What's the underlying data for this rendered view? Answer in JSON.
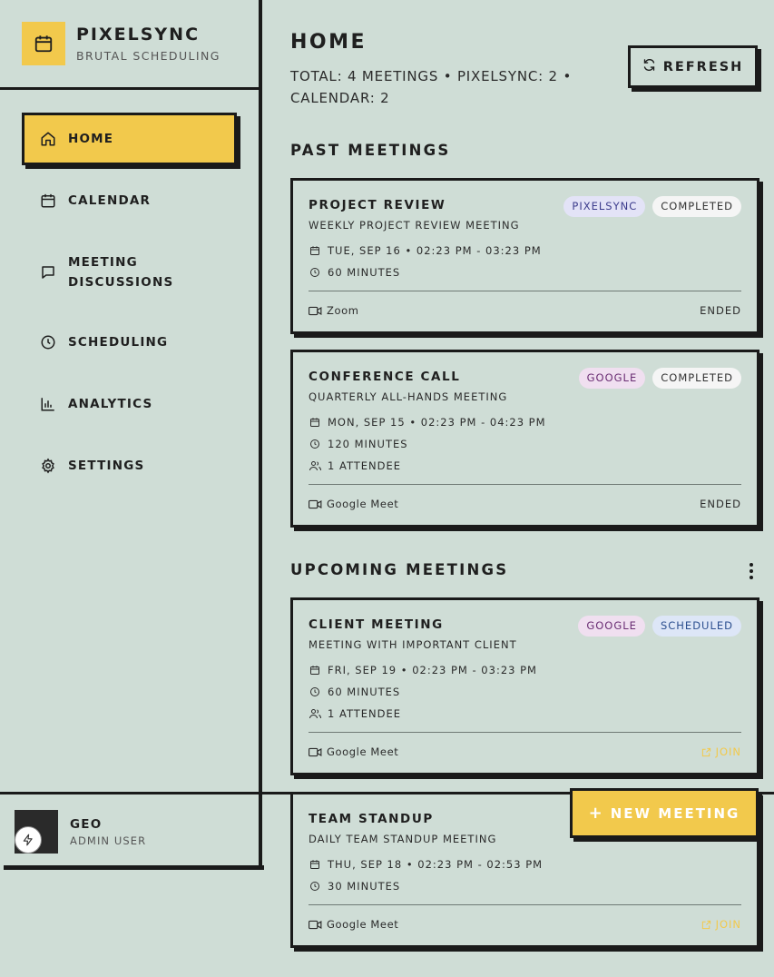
{
  "brand": {
    "name": "PIXELSYNC",
    "subtitle": "BRUTAL SCHEDULING",
    "icon": "calendar-icon"
  },
  "nav": [
    {
      "label": "HOME",
      "icon": "home-icon",
      "active": true
    },
    {
      "label": "CALENDAR",
      "icon": "calendar-icon",
      "active": false
    },
    {
      "label": "MEETING\nDISCUSSIONS",
      "icon": "message-icon",
      "active": false
    },
    {
      "label": "SCHEDULING",
      "icon": "clock-icon",
      "active": false
    },
    {
      "label": "ANALYTICS",
      "icon": "bar-chart-icon",
      "active": false
    },
    {
      "label": "SETTINGS",
      "icon": "gear-icon",
      "active": false
    }
  ],
  "user": {
    "name": "GEO",
    "role": "ADMIN USER"
  },
  "header": {
    "title": "HOME",
    "summary": "TOTAL: 4 MEETINGS • PIXELSYNC: 2 • CALENDAR: 2",
    "refresh_label": "REFRESH"
  },
  "sections": {
    "past": "PAST MEETINGS",
    "upcoming": "UPCOMING MEETINGS"
  },
  "meetings": [
    {
      "title": "PROJECT REVIEW",
      "description": "WEEKLY PROJECT REVIEW MEETING",
      "source": "PIXELSYNC",
      "status": "COMPLETED",
      "datetime": "TUE, SEP 16 • 02:23 PM - 03:23 PM",
      "duration": "60 MINUTES",
      "attendees": "",
      "platform": "Zoom",
      "action": "ENDED"
    },
    {
      "title": "CONFERENCE CALL",
      "description": "QUARTERLY ALL-HANDS MEETING",
      "source": "GOOGLE",
      "status": "COMPLETED",
      "datetime": "MON, SEP 15 • 02:23 PM - 04:23 PM",
      "duration": "120 MINUTES",
      "attendees": "1 ATTENDEE",
      "platform": "Google Meet",
      "action": "ENDED"
    },
    {
      "title": "CLIENT MEETING",
      "description": "MEETING WITH IMPORTANT CLIENT",
      "source": "GOOGLE",
      "status": "SCHEDULED",
      "datetime": "FRI, SEP 19 • 02:23 PM - 03:23 PM",
      "duration": "60 MINUTES",
      "attendees": "1 ATTENDEE",
      "platform": "Google Meet",
      "action": "JOIN"
    },
    {
      "title": "TEAM STANDUP",
      "description": "DAILY TEAM STANDUP MEETING",
      "source": "",
      "status": "",
      "datetime": "THU, SEP 18 • 02:23 PM - 02:53 PM",
      "duration": "30 MINUTES",
      "attendees": "",
      "platform": "Google Meet",
      "action": "JOIN"
    }
  ],
  "new_meeting": {
    "label": "NEW MEETING"
  },
  "colors": {
    "background": "#cfddd6",
    "accent": "#f2c94c",
    "ink": "#1a1a1a"
  }
}
